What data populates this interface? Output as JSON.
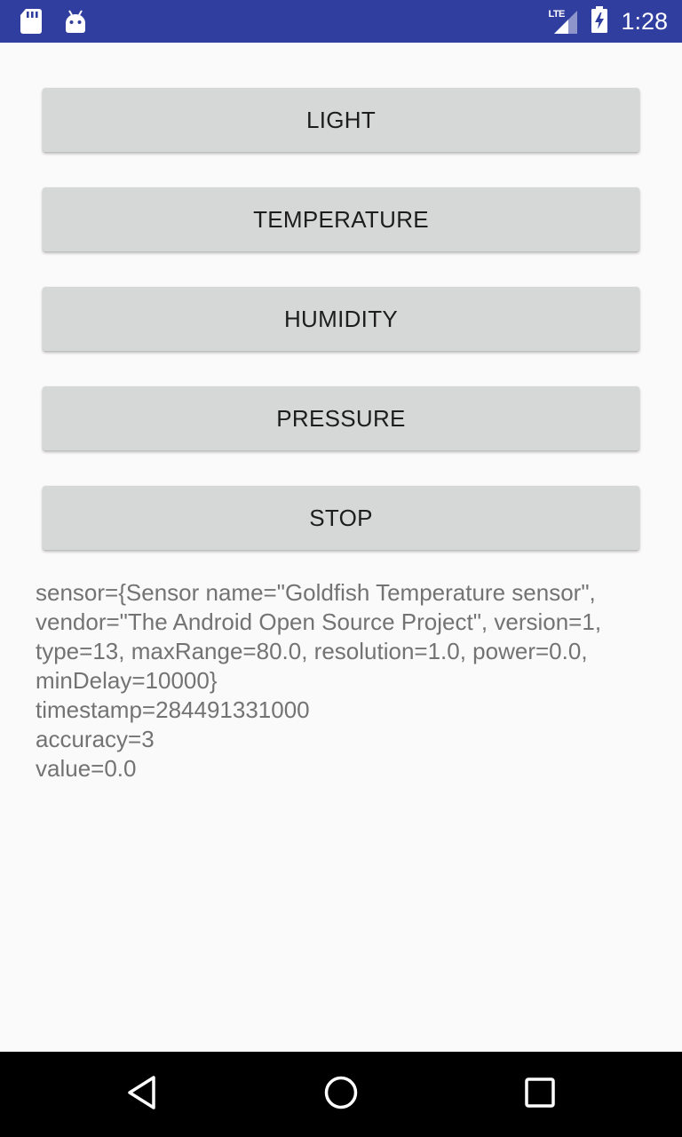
{
  "status_bar": {
    "background": "#303f9f",
    "left_icons": [
      "sd-card-icon",
      "android-icon"
    ],
    "network_label": "LTE",
    "time": "1:28"
  },
  "buttons": {
    "light": "LIGHT",
    "temperature": "TEMPERATURE",
    "humidity": "HUMIDITY",
    "pressure": "PRESSURE",
    "stop": "STOP"
  },
  "sensor_readout": {
    "lines": [
      "sensor={Sensor name=\"Goldfish Temperature sensor\",",
      "vendor=\"The Android Open Source Project\", version=1,",
      "type=13, maxRange=80.0, resolution=1.0, power=0.0,",
      "minDelay=10000}",
      "timestamp=284491331000",
      "accuracy=3",
      "value=0.0"
    ]
  },
  "nav_bar": {
    "icons": [
      "back-icon",
      "home-icon",
      "recents-icon"
    ]
  }
}
